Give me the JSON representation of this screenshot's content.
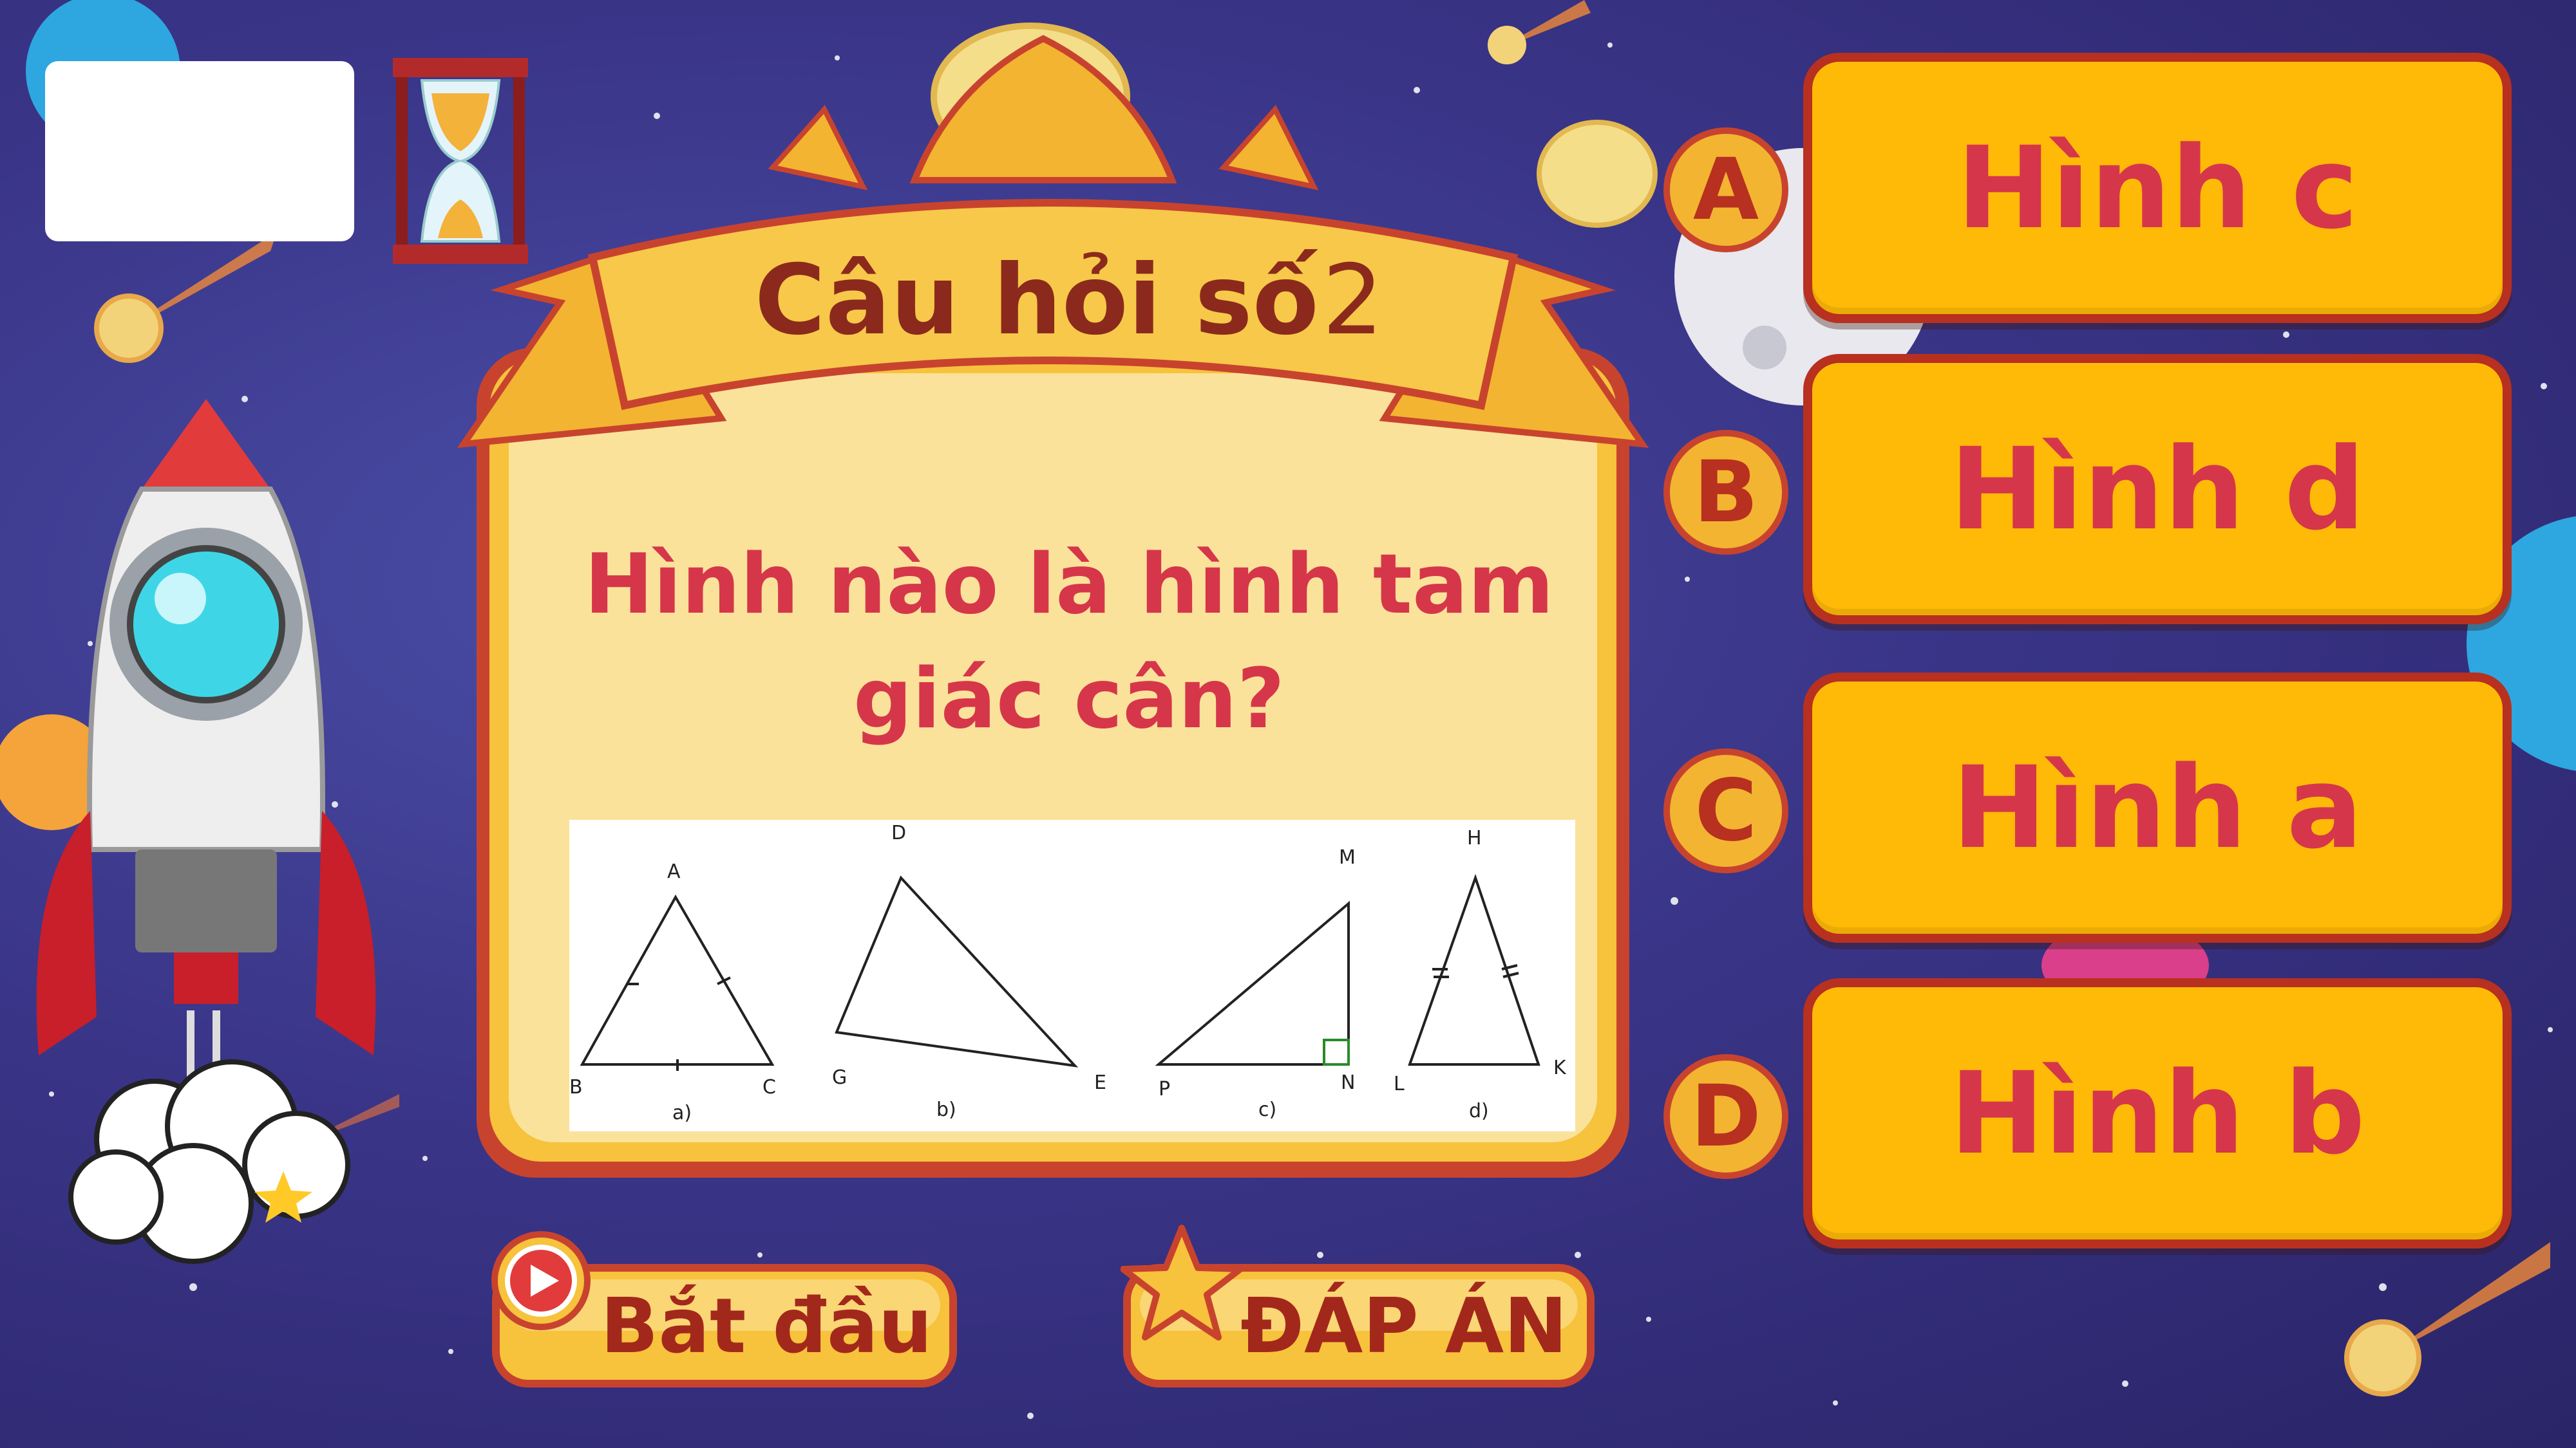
{
  "header": {
    "title_prefix": "Câu hỏi số",
    "title_number": "2"
  },
  "question": {
    "text": "Hình nào là hình tam giác cân?"
  },
  "figure": {
    "vertex_labels": {
      "a": [
        "A",
        "B",
        "C"
      ],
      "b": [
        "D",
        "G",
        "E"
      ],
      "c": [
        "M",
        "P",
        "N"
      ],
      "d": [
        "H",
        "L",
        "K"
      ]
    },
    "captions": [
      "a)",
      "b)",
      "c)",
      "d)"
    ]
  },
  "answers": [
    {
      "letter": "A",
      "label": "Hình c"
    },
    {
      "letter": "B",
      "label": "Hình d"
    },
    {
      "letter": "C",
      "label": "Hình a"
    },
    {
      "letter": "D",
      "label": "Hình b"
    }
  ],
  "buttons": {
    "start_label": "Bắt đầu",
    "answer_label": "ĐÁP ÁN"
  },
  "colors": {
    "primary_red": "#d6364a",
    "answer_card_fill": "#ffba08",
    "answer_card_border": "#b8301f",
    "background": "#3a3588"
  },
  "icons": [
    "hourglass-icon",
    "rocket-icon",
    "play-icon",
    "star-icon",
    "meteor-icon",
    "moon-icon",
    "planet-icon"
  ]
}
